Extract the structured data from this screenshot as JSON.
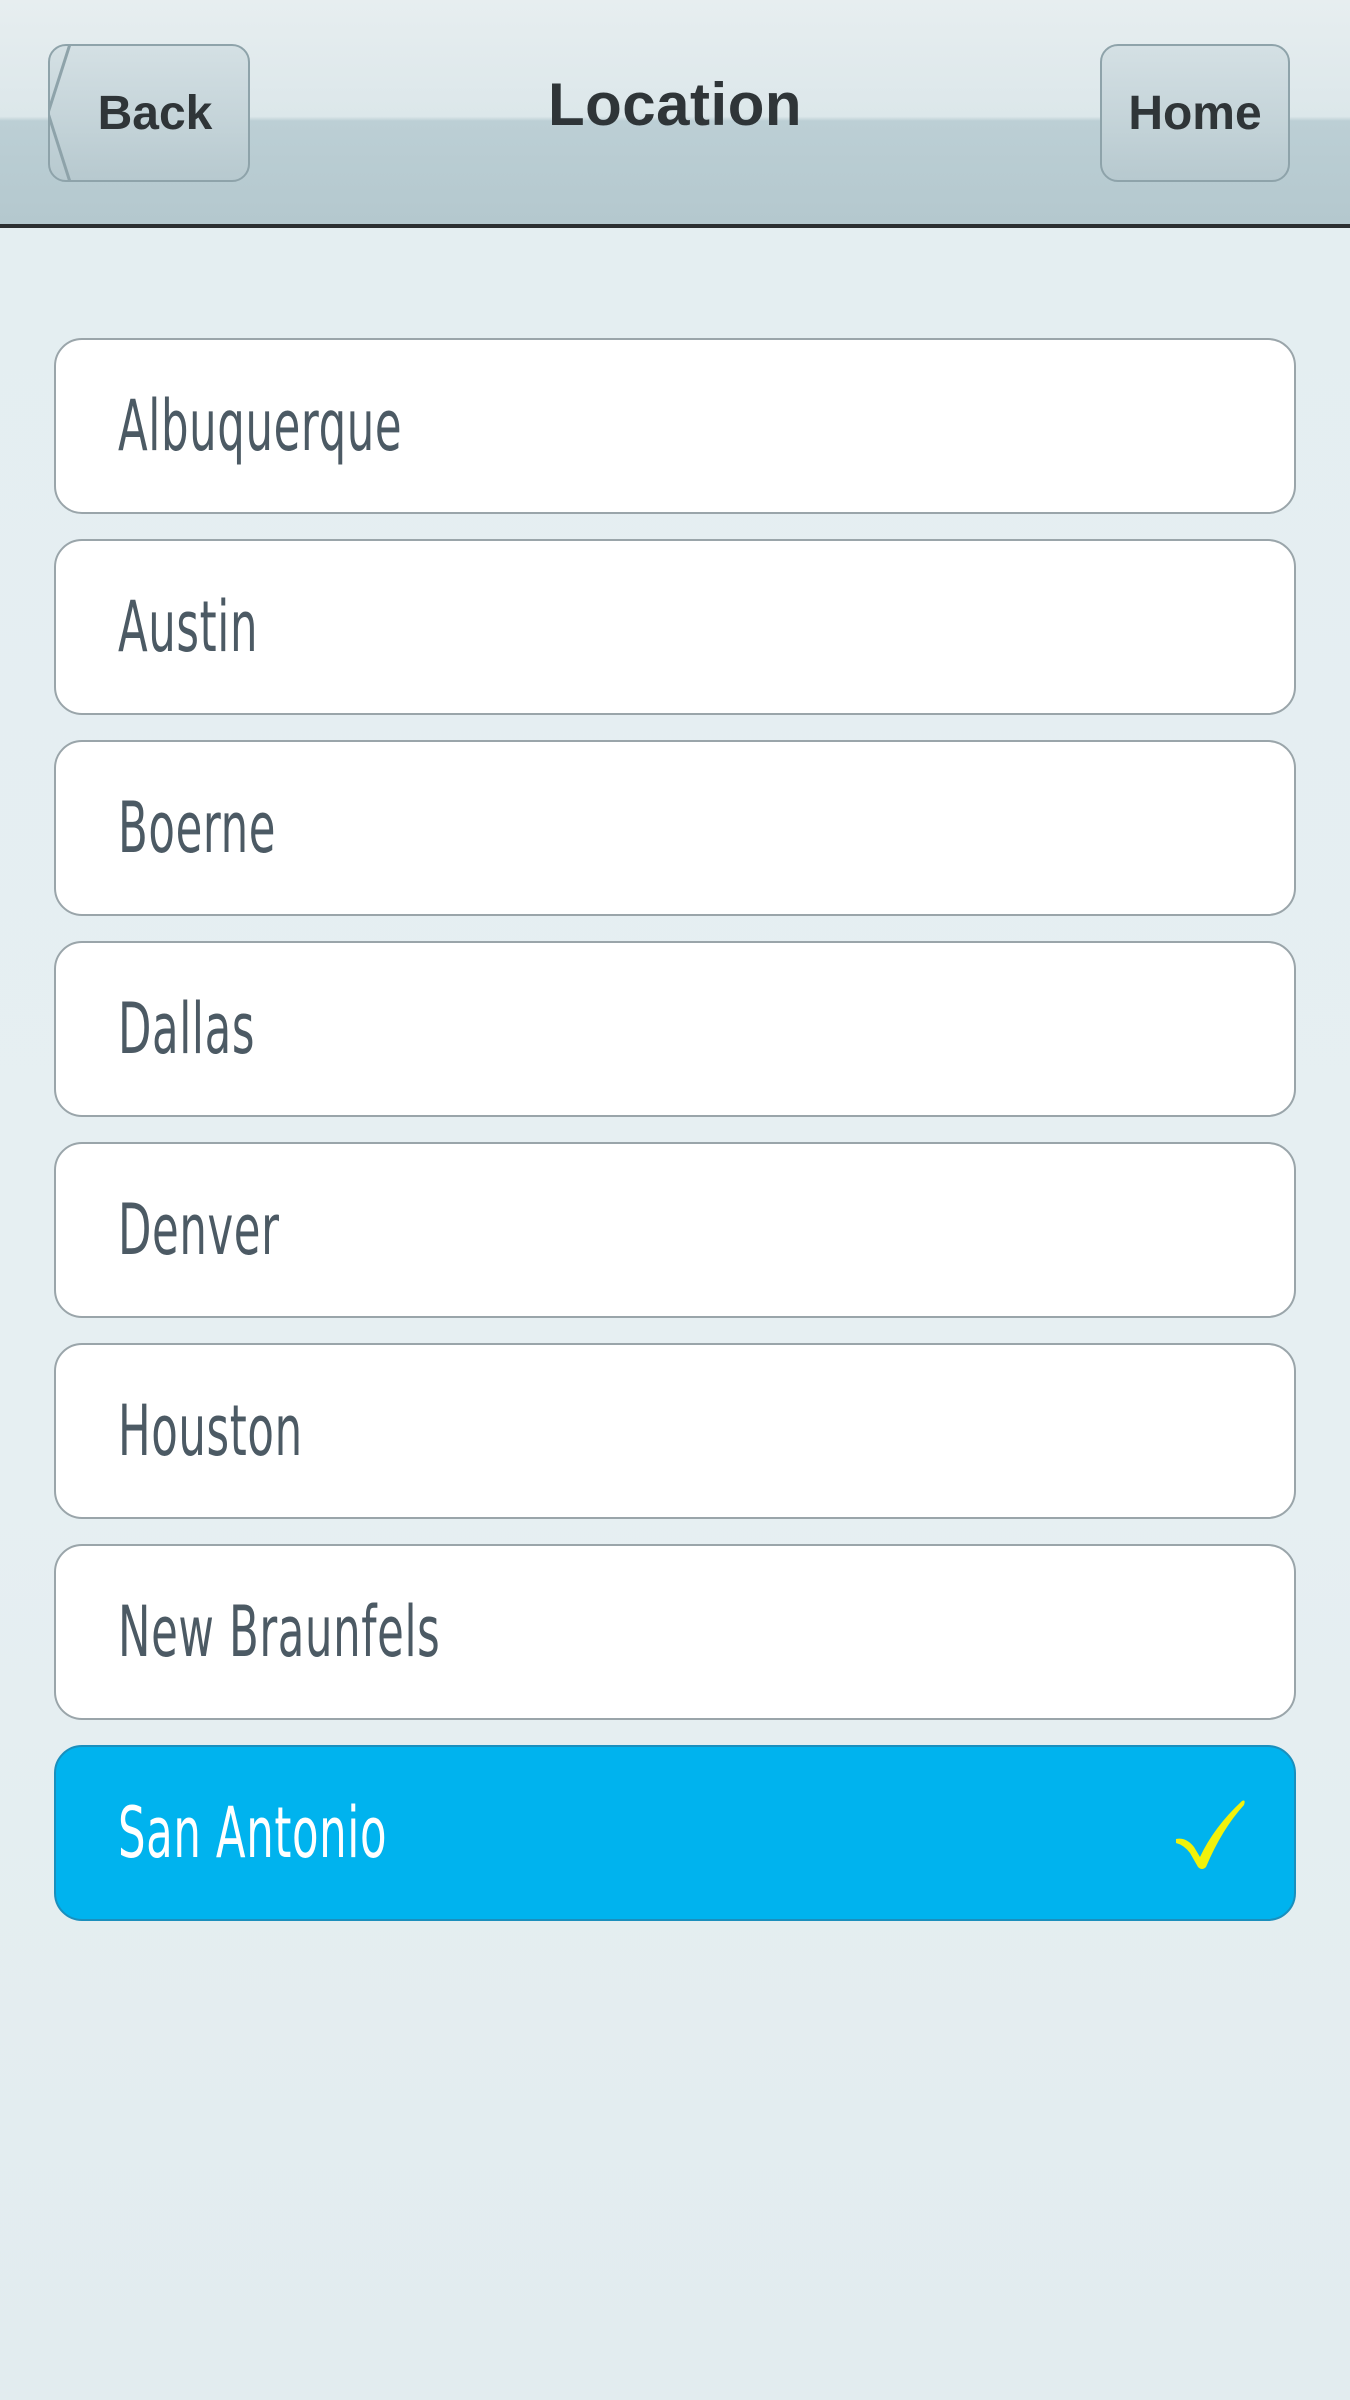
{
  "nav": {
    "title": "Location",
    "back_label": "Back",
    "home_label": "Home"
  },
  "locations": [
    {
      "label": "Albuquerque",
      "selected": false
    },
    {
      "label": "Austin",
      "selected": false
    },
    {
      "label": "Boerne",
      "selected": false
    },
    {
      "label": "Dallas",
      "selected": false
    },
    {
      "label": "Denver",
      "selected": false
    },
    {
      "label": "Houston",
      "selected": false
    },
    {
      "label": "New Braunfels",
      "selected": false
    },
    {
      "label": "San Antonio",
      "selected": true
    }
  ],
  "colors": {
    "selected_background": "#00b3ee",
    "checkmark": "#f2f20a",
    "item_text": "#4c5a64"
  },
  "icons": {
    "selected_marker": "checkmark-icon",
    "back_button_shape": "back-arrow-button"
  }
}
